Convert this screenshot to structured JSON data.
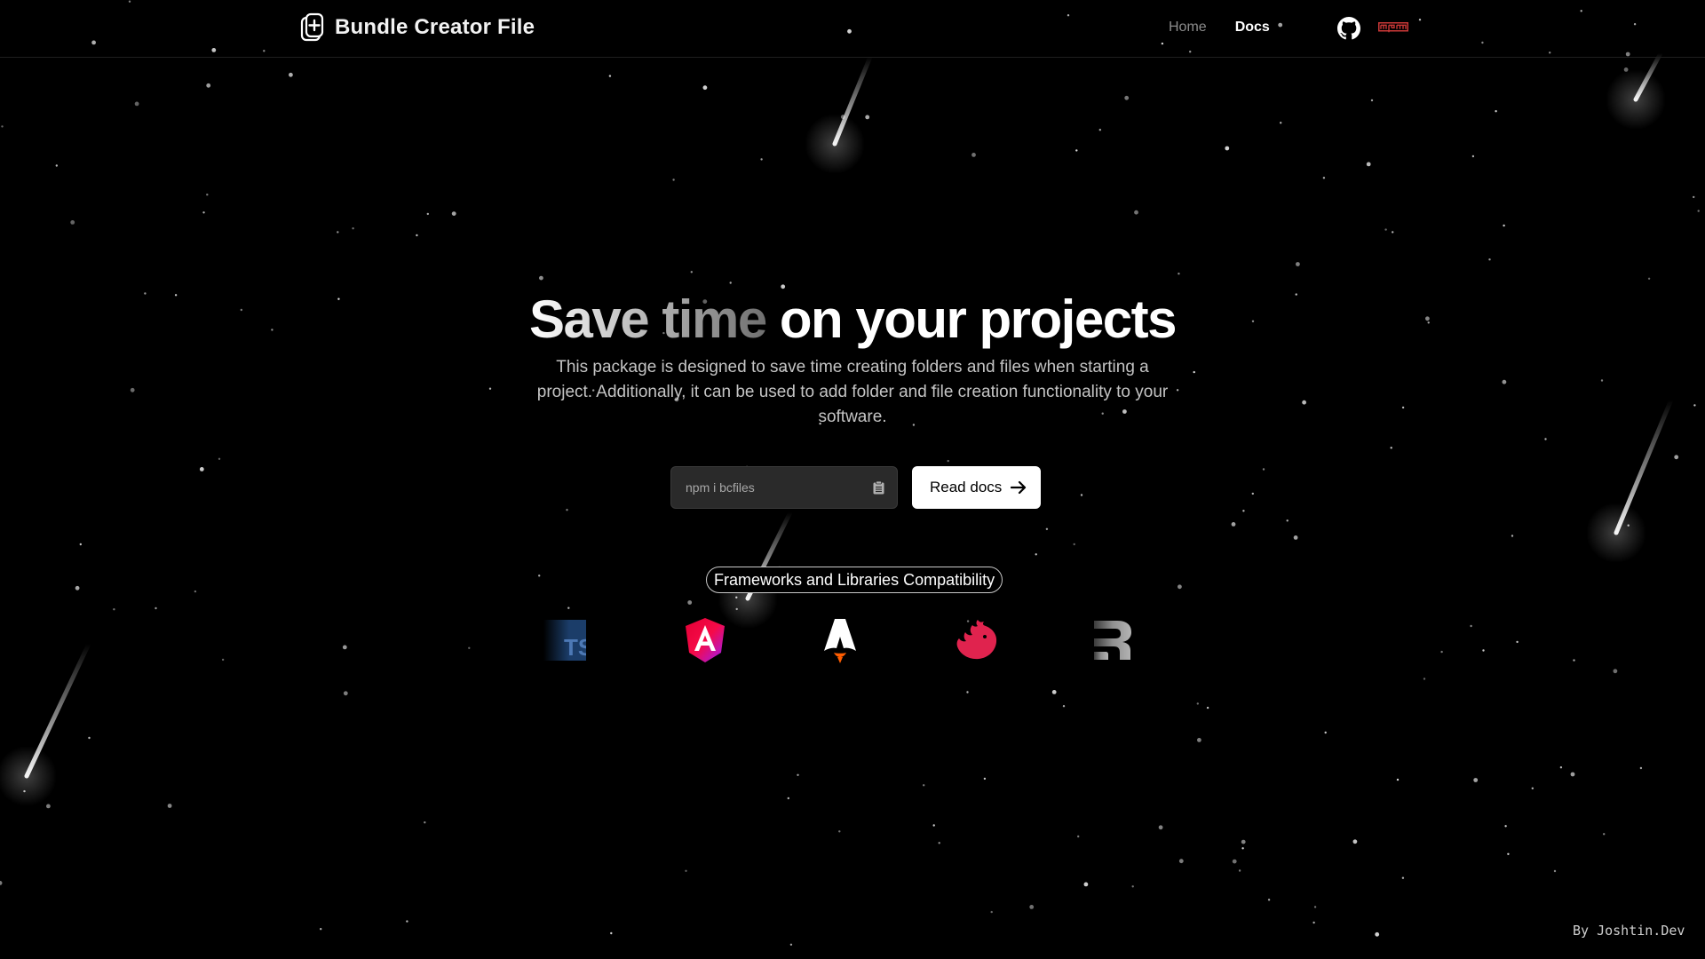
{
  "app": {
    "title": "Bundle Creator File"
  },
  "nav": {
    "items": [
      {
        "label": "Home",
        "active": false
      },
      {
        "label": "Docs",
        "active": true
      }
    ],
    "social": [
      {
        "icon": "github-icon"
      },
      {
        "icon": "npm-icon",
        "text": "npm",
        "color": "#cb3837"
      }
    ]
  },
  "hero": {
    "title_part1": "Save time",
    "title_part2": "on your projects",
    "description": "This package is designed to save time creating folders and files when starting a project. Additionally, it can be used to add folder and file creation functionality to your software.",
    "install_placeholder": "npm i bcfiles",
    "copy_icon": "clipboard-icon",
    "read_docs_label": "Read docs",
    "read_docs_icon": "arrow-right-icon"
  },
  "compatibility": {
    "label": "Frameworks and Libraries Compatibility",
    "logos": [
      {
        "name": "TypeScript",
        "icon": "typescript-icon",
        "text": "TS",
        "color": "#3178c6"
      },
      {
        "name": "Angular",
        "icon": "angular-icon",
        "color": "#dd0031"
      },
      {
        "name": "Astro",
        "icon": "astro-icon",
        "color": "#ff5d01"
      },
      {
        "name": "NestJS",
        "icon": "nestjs-icon",
        "color": "#e0234e"
      },
      {
        "name": "Remix",
        "icon": "remix-icon",
        "color": "#b5b5b5"
      }
    ]
  },
  "footer": {
    "credit": "By Joshtin.Dev"
  },
  "colors": {
    "background": "#000000",
    "text": "#ffffff",
    "muted": "#8c8c8c",
    "npm_red": "#cb3837"
  }
}
